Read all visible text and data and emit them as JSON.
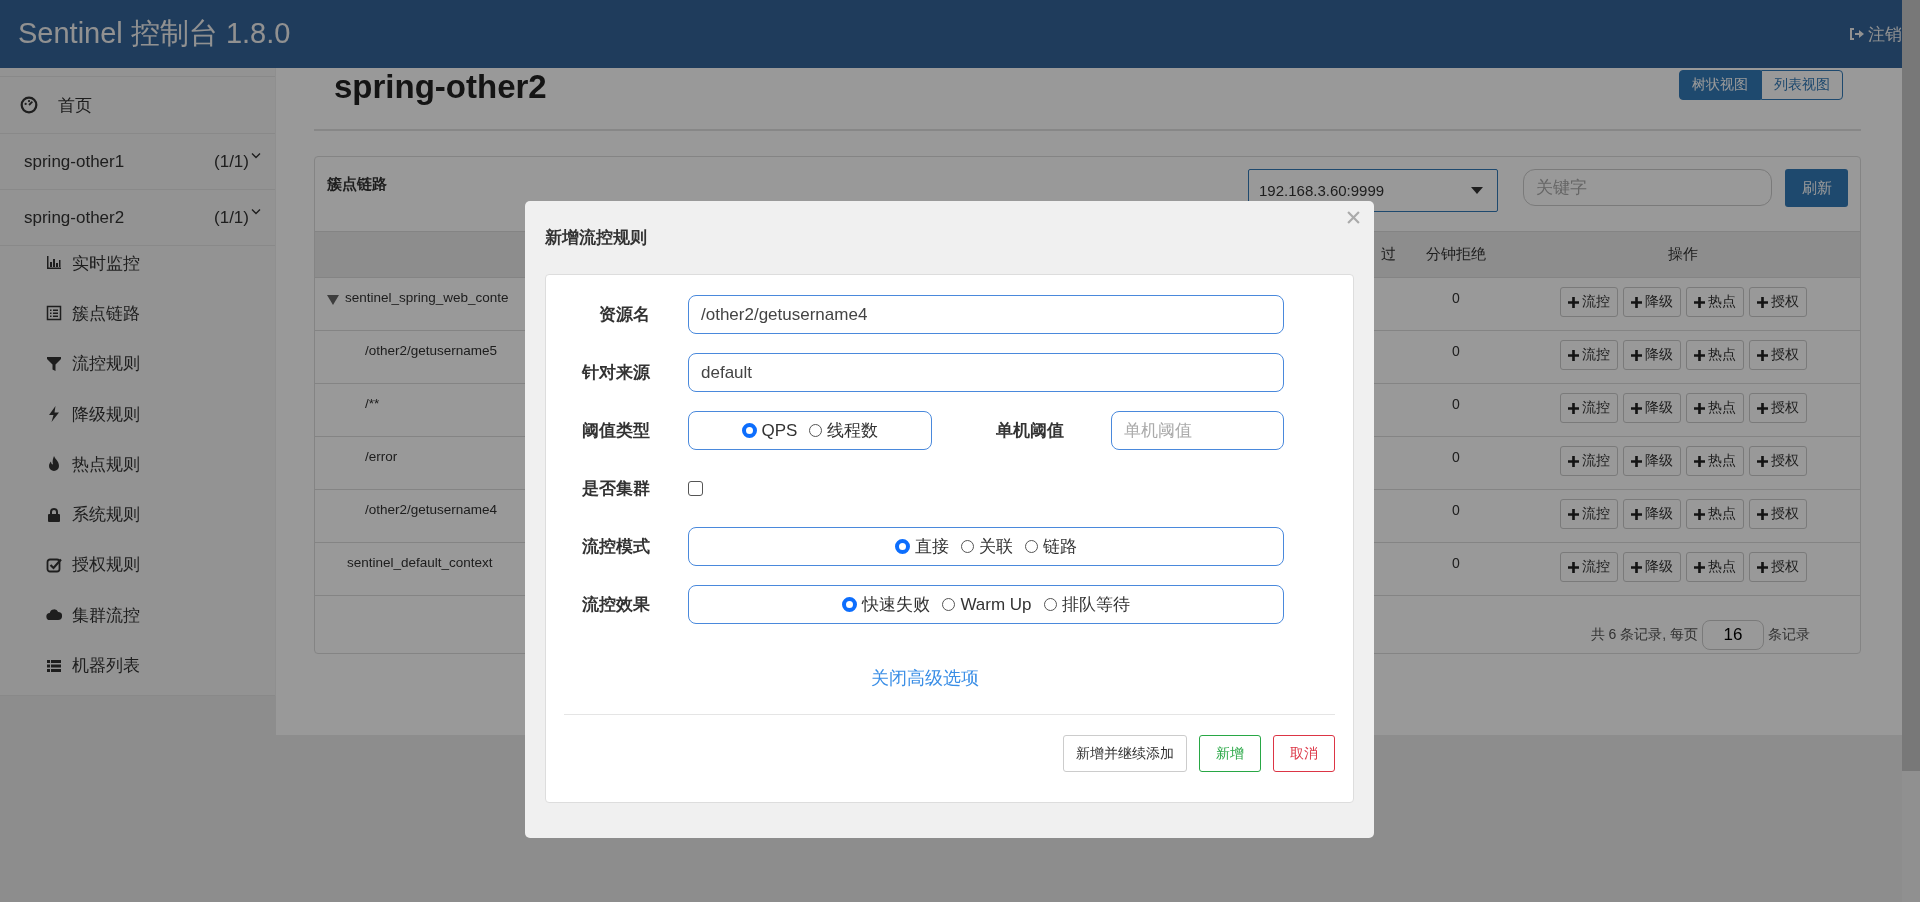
{
  "header": {
    "title": "Sentinel 控制台 1.8.0",
    "logout": "注销"
  },
  "sidebar": {
    "home": "首页",
    "apps": [
      {
        "name": "spring-other1",
        "count": "(1/1)"
      },
      {
        "name": "spring-other2",
        "count": "(1/1)",
        "items": [
          {
            "label": "实时监控"
          },
          {
            "label": "簇点链路"
          },
          {
            "label": "流控规则"
          },
          {
            "label": "降级规则"
          },
          {
            "label": "热点规则"
          },
          {
            "label": "系统规则"
          },
          {
            "label": "授权规则"
          },
          {
            "label": "集群流控"
          },
          {
            "label": "机器列表"
          }
        ]
      }
    ]
  },
  "page": {
    "title": "spring-other2",
    "view_tabs": [
      {
        "label": "树状视图",
        "selected": true
      },
      {
        "label": "列表视图",
        "selected": false
      }
    ]
  },
  "panel": {
    "title": "簇点链路",
    "machine": "192.168.3.60:9999",
    "search": {
      "placeholder": "关键字"
    },
    "refresh": "刷新",
    "table": {
      "columns": [
        "过",
        "分钟拒绝",
        "操作"
      ],
      "rows": [
        {
          "resource": "sentinel_spring_web_conte",
          "rejected": "0",
          "actions": [
            "流控",
            "降级",
            "热点",
            "授权"
          ],
          "expanded": true,
          "children": [
            {
              "resource": "/other2/getusername5",
              "rejected": "0",
              "actions": [
                "流控",
                "降级",
                "热点",
                "授权"
              ]
            },
            {
              "resource": "/**",
              "rejected": "0",
              "actions": [
                "流控",
                "降级",
                "热点",
                "授权"
              ]
            },
            {
              "resource": "/error",
              "rejected": "0",
              "actions": [
                "流控",
                "降级",
                "热点",
                "授权"
              ]
            },
            {
              "resource": "/other2/getusername4",
              "rejected": "0",
              "actions": [
                "流控",
                "降级",
                "热点",
                "授权"
              ]
            }
          ]
        },
        {
          "resource": "sentinel_default_context",
          "rejected": "0",
          "actions": [
            "流控",
            "降级",
            "热点",
            "授权"
          ]
        }
      ]
    },
    "pagination": {
      "summary": "共 6 条记录, 每页",
      "page_size": "16",
      "suffix": "条记录"
    }
  },
  "dialog": {
    "title": "新增流控规则",
    "fields": [
      {
        "kind": "text",
        "label": "资源名",
        "value": "/other2/getusername4"
      },
      {
        "kind": "text",
        "label": "针对来源",
        "value": "default"
      },
      {
        "kind": "radio",
        "label": "阈值类型",
        "options": [
          {
            "label": "QPS",
            "selected": true
          },
          {
            "label": "线程数",
            "selected": false
          }
        ],
        "extra": {
          "label": "单机阈值",
          "placeholder": "单机阈值"
        }
      },
      {
        "kind": "checkbox",
        "label": "是否集群",
        "checked": false
      },
      {
        "kind": "radio",
        "label": "流控模式",
        "options": [
          {
            "label": "直接",
            "selected": true
          },
          {
            "label": "关联",
            "selected": false
          },
          {
            "label": "链路",
            "selected": false
          }
        ]
      },
      {
        "kind": "radio",
        "label": "流控效果",
        "options": [
          {
            "label": "快速失败",
            "selected": true
          },
          {
            "label": "Warm Up",
            "selected": false
          },
          {
            "label": "排队等待",
            "selected": false
          }
        ]
      }
    ],
    "advanced_link": "关闭高级选项",
    "buttons": [
      {
        "label": "新增并继续添加",
        "kind": "default"
      },
      {
        "label": "新增",
        "kind": "success"
      },
      {
        "label": "取消",
        "kind": "danger"
      }
    ]
  }
}
